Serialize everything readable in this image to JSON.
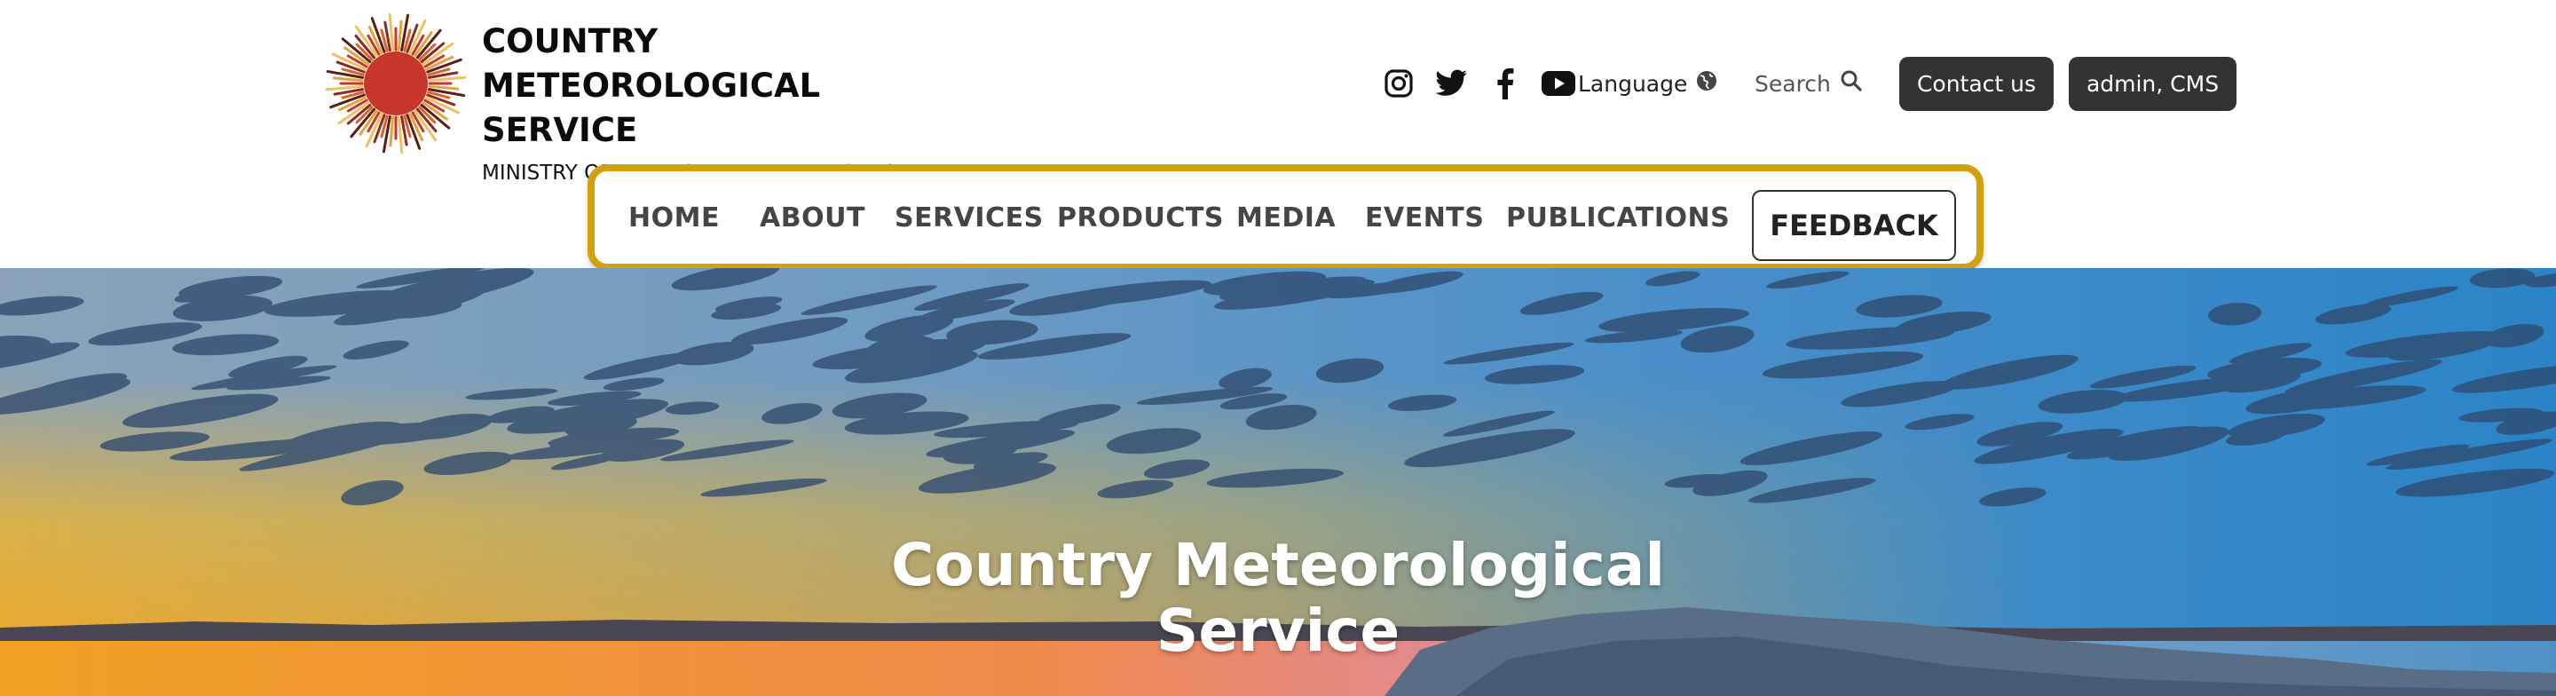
{
  "brand": {
    "title_line1": "COUNTRY METEOROLOGICAL",
    "title_line2": "SERVICE",
    "subtitle": "MINISTRY OF ENVIRONMENT AND FORESTRY",
    "logo_icon": "sun-logo-icon"
  },
  "social": {
    "icons": [
      "instagram-icon",
      "twitter-icon",
      "facebook-icon",
      "youtube-icon"
    ]
  },
  "utility": {
    "language_label": "Language",
    "language_icon": "globe-icon",
    "search_label": "Search",
    "search_icon": "search-icon",
    "contact_label": "Contact us",
    "admin_label": "admin, CMS"
  },
  "nav": {
    "items": [
      {
        "label": "HOME"
      },
      {
        "label": "ABOUT"
      },
      {
        "label": "SERVICES"
      },
      {
        "label": "PRODUCTS"
      },
      {
        "label": "MEDIA"
      },
      {
        "label": "EVENTS"
      },
      {
        "label": "PUBLICATIONS"
      }
    ],
    "feedback_label": "FEEDBACK",
    "highlight_color": "#d4a10e"
  },
  "hero": {
    "title_line1": "Country Meteorological",
    "title_line2": "Service"
  },
  "colors": {
    "button_bg": "#333333",
    "logo_red": "#c8352a",
    "sky_blue": "#3f8dc6",
    "sunset_orange": "#f3a21e"
  }
}
